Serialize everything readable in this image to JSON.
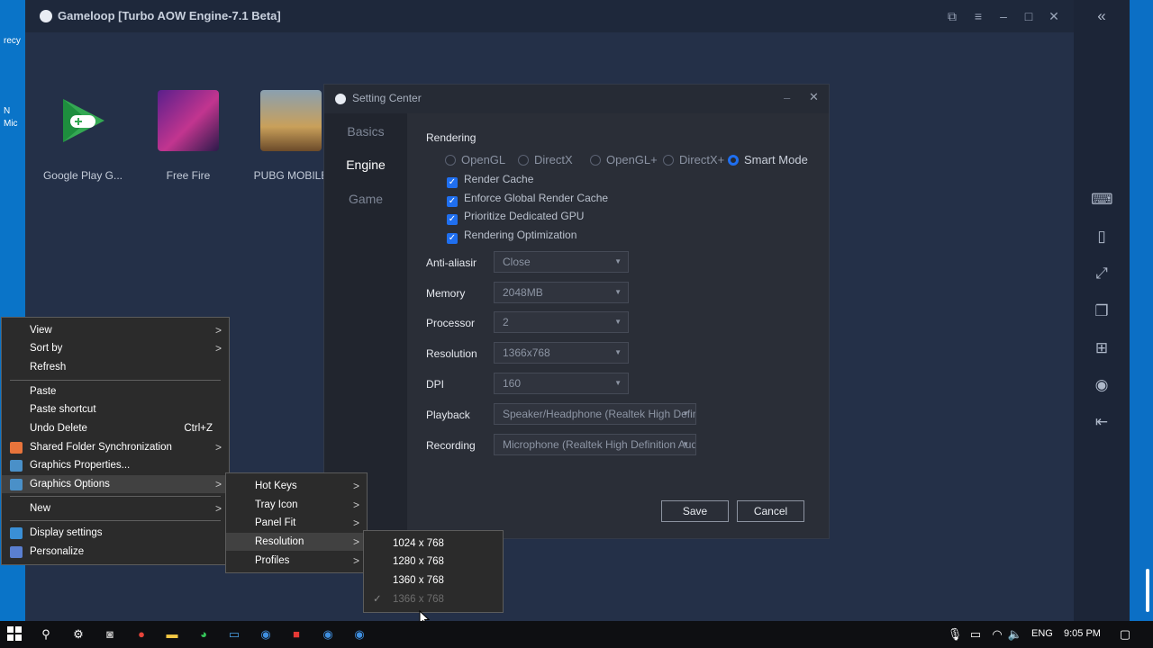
{
  "desktop": {
    "left_labels": [
      "recy",
      "N",
      "Mic"
    ]
  },
  "gameloop": {
    "title": "Gameloop  [Turbo AOW Engine-7.1 Beta]",
    "apps": [
      {
        "label": "Google Play G..."
      },
      {
        "label": "Free Fire"
      },
      {
        "label": "PUBG MOBILE"
      }
    ]
  },
  "setting_center": {
    "title": "Setting Center",
    "nav": [
      "Basics",
      "Engine",
      "Game"
    ],
    "active_nav": "Engine",
    "rendering": {
      "heading": "Rendering",
      "modes": [
        "OpenGL",
        "DirectX",
        "OpenGL+",
        "DirectX+",
        "Smart Mode"
      ],
      "selected_mode": "Smart Mode",
      "checkboxes": [
        "Render Cache",
        "Enforce Global Render Cache",
        "Prioritize Dedicated GPU",
        "Rendering Optimization"
      ]
    },
    "fields": [
      {
        "label": "Anti-aliasing",
        "value": "Close"
      },
      {
        "label": "Memory",
        "value": "2048MB"
      },
      {
        "label": "Processor",
        "value": "2"
      },
      {
        "label": "Resolution",
        "value": "1366x768"
      },
      {
        "label": "DPI",
        "value": "160"
      },
      {
        "label": "Playback",
        "value": "Speaker/Headphone (Realtek High Definition Audio)"
      },
      {
        "label": "Recording",
        "value": "Microphone (Realtek High Definition Audio)"
      }
    ],
    "save_label": "Save",
    "cancel_label": "Cancel"
  },
  "context_menu": {
    "view": "View",
    "sort_by": "Sort by",
    "refresh": "Refresh",
    "paste": "Paste",
    "paste_shortcut": "Paste shortcut",
    "undo_delete": "Undo Delete",
    "undo_shortcut": "Ctrl+Z",
    "shared_folder": "Shared Folder Synchronization",
    "graphics_properties": "Graphics Properties...",
    "graphics_options": "Graphics Options",
    "new": "New",
    "display_settings": "Display settings",
    "personalize": "Personalize"
  },
  "graphics_submenu": {
    "hot_keys": "Hot Keys",
    "tray_icon": "Tray Icon",
    "panel_fit": "Panel Fit",
    "resolution": "Resolution",
    "profiles": "Profiles"
  },
  "resolution_submenu": {
    "items": [
      "1024 x 768",
      "1280 x 768",
      "1360 x 768",
      "1366 x 768"
    ],
    "checked": "1366 x 768"
  },
  "taskbar": {
    "language": "ENG",
    "time": "9:05 PM"
  },
  "colors": {
    "accent": "#1f6ff0",
    "dialog_bg": "#262b35",
    "taskbar_bg": "#0e0f12"
  }
}
